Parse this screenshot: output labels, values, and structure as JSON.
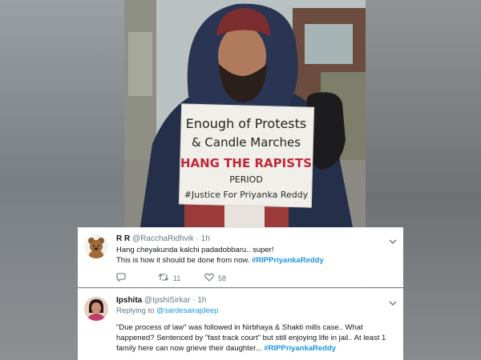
{
  "photo": {
    "sign_lines": [
      "Enough of Protests",
      "& Candle Marches",
      "HANG THE RAPISTS",
      "PERIOD",
      "#Justice For Priyanka Reddy"
    ]
  },
  "tweets": [
    {
      "name": "R R",
      "handle": "@RacchaRidhvik",
      "sep": "·",
      "time": "1h",
      "body_line1": "Hang cheyakunda kalchi padadobbaru.. super!",
      "body_line2": "This is how it should be done from now.",
      "hashtag": "#RIPPriyankaReddy",
      "retweets": "11",
      "likes": "58",
      "avatar_icon": "teddy-bear-avatar"
    },
    {
      "name": "Ipshita",
      "handle": "@IpshiSirkar",
      "sep": "·",
      "time": "1h",
      "replying_prefix": "Replying to",
      "replying_to": "@sardesairajdeep",
      "body_line1": "\"Due process of law\" was followed in Nirbhaya & Shakti mills case.. What",
      "body_line2": "happened? Sentenced by \"fast track court\" but still enjoying life in jail.. At least 1",
      "body_line3": "family here can now grieve their daughter...",
      "hashtag": "#RIPPriyankaReddy",
      "avatar_icon": "woman-portrait-avatar"
    }
  ],
  "colors": {
    "link": "#1b95e0",
    "muted": "#657786",
    "sign_red": "#c0283a"
  }
}
